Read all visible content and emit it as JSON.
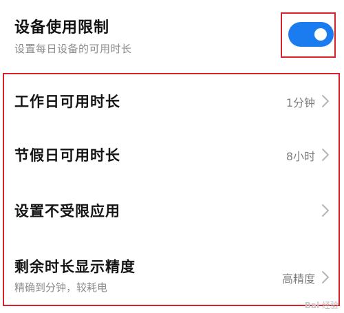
{
  "header": {
    "title": "设备使用限制",
    "subtitle": "设置每日设备的可用时长",
    "toggle_on": true,
    "toggle_color": "#1b7cf0"
  },
  "settings": [
    {
      "label": "工作日可用时长",
      "value": "1分钟"
    },
    {
      "label": "节假日可用时长",
      "value": "8小时"
    },
    {
      "label": "设置不受限应用",
      "value": ""
    },
    {
      "label": "剩余时长显示精度",
      "subtitle": "精确到分钟，较耗电",
      "value": "高精度"
    }
  ],
  "watermark": {
    "logo": "Bai",
    "text": "经验"
  },
  "highlight_color": "#d6232b"
}
